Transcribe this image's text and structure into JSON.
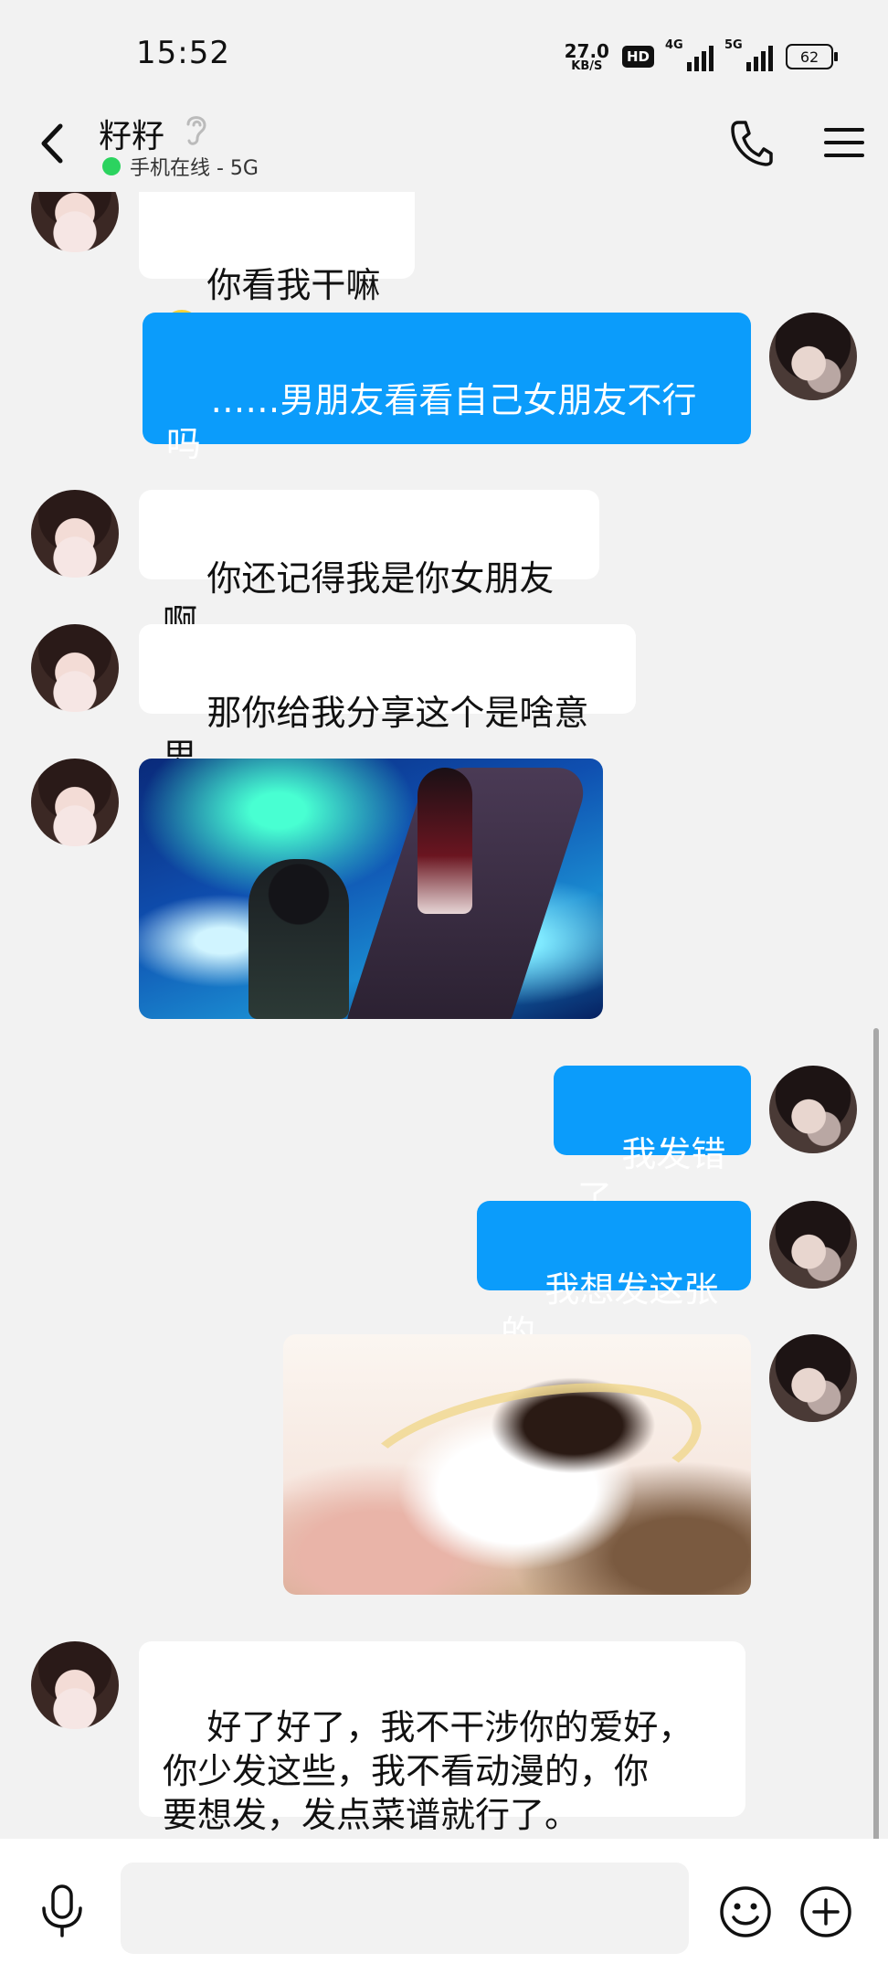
{
  "status_bar": {
    "time": "15:52",
    "net_speed_value": "27.0",
    "net_speed_unit": "KB/S",
    "hd_label": "HD",
    "signal1_label": "4G",
    "signal2_label": "5G",
    "battery": "62"
  },
  "header": {
    "contact_name": "籽籽",
    "online_status": "手机在线 - 5G"
  },
  "messages": [
    {
      "side": "in",
      "text": "你看我干嘛"
    },
    {
      "side": "out",
      "text": "……男朋友看看自己女朋友不行\n吗"
    },
    {
      "side": "in",
      "text": "你还记得我是你女朋友啊"
    },
    {
      "side": "in",
      "text": "那你给我分享这个是啥意思"
    },
    {
      "side": "in",
      "type": "image"
    },
    {
      "side": "out",
      "text": "我发错了"
    },
    {
      "side": "out",
      "text": "我想发这张的"
    },
    {
      "side": "out",
      "type": "image"
    },
    {
      "side": "in",
      "text": "好了好了，我不干涉你的爱好，\n你少发这些，我不看动漫的，你\n要想发，发点菜谱就行了。"
    }
  ],
  "colors": {
    "outgoing_bubble": "#0b9cfb",
    "incoming_bubble": "#ffffff",
    "background": "#f2f2f2",
    "online_dot": "#2bd35f"
  },
  "icons": {
    "back": "chevron-left-icon",
    "ear": "ear-icon",
    "call": "phone-icon",
    "menu": "hamburger-menu-icon",
    "voice": "microphone-icon",
    "emoji": "smiley-icon",
    "more": "plus-circle-icon"
  }
}
